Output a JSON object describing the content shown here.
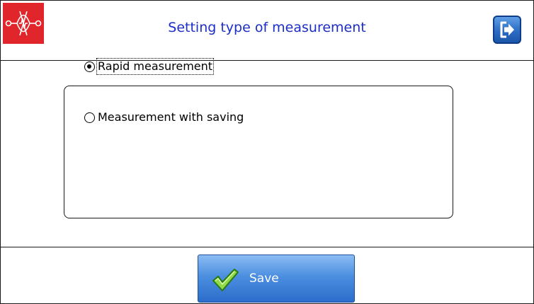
{
  "header": {
    "title": "Setting type of measurement",
    "logo_icon": "logo-icon",
    "exit_icon": "exit-icon"
  },
  "measurement_options": {
    "selected": "Rapid measurement",
    "items": [
      {
        "label": "Rapid measurement",
        "checked": true,
        "focused": true
      },
      {
        "label": "Measurement with saving",
        "checked": false,
        "focused": false
      }
    ]
  },
  "footer": {
    "save_label": "Save",
    "save_icon": "checkmark-icon"
  },
  "colors": {
    "title_text": "#1c2ec8",
    "logo_background": "#e0262b",
    "button_blue": "#2c6ccb"
  }
}
